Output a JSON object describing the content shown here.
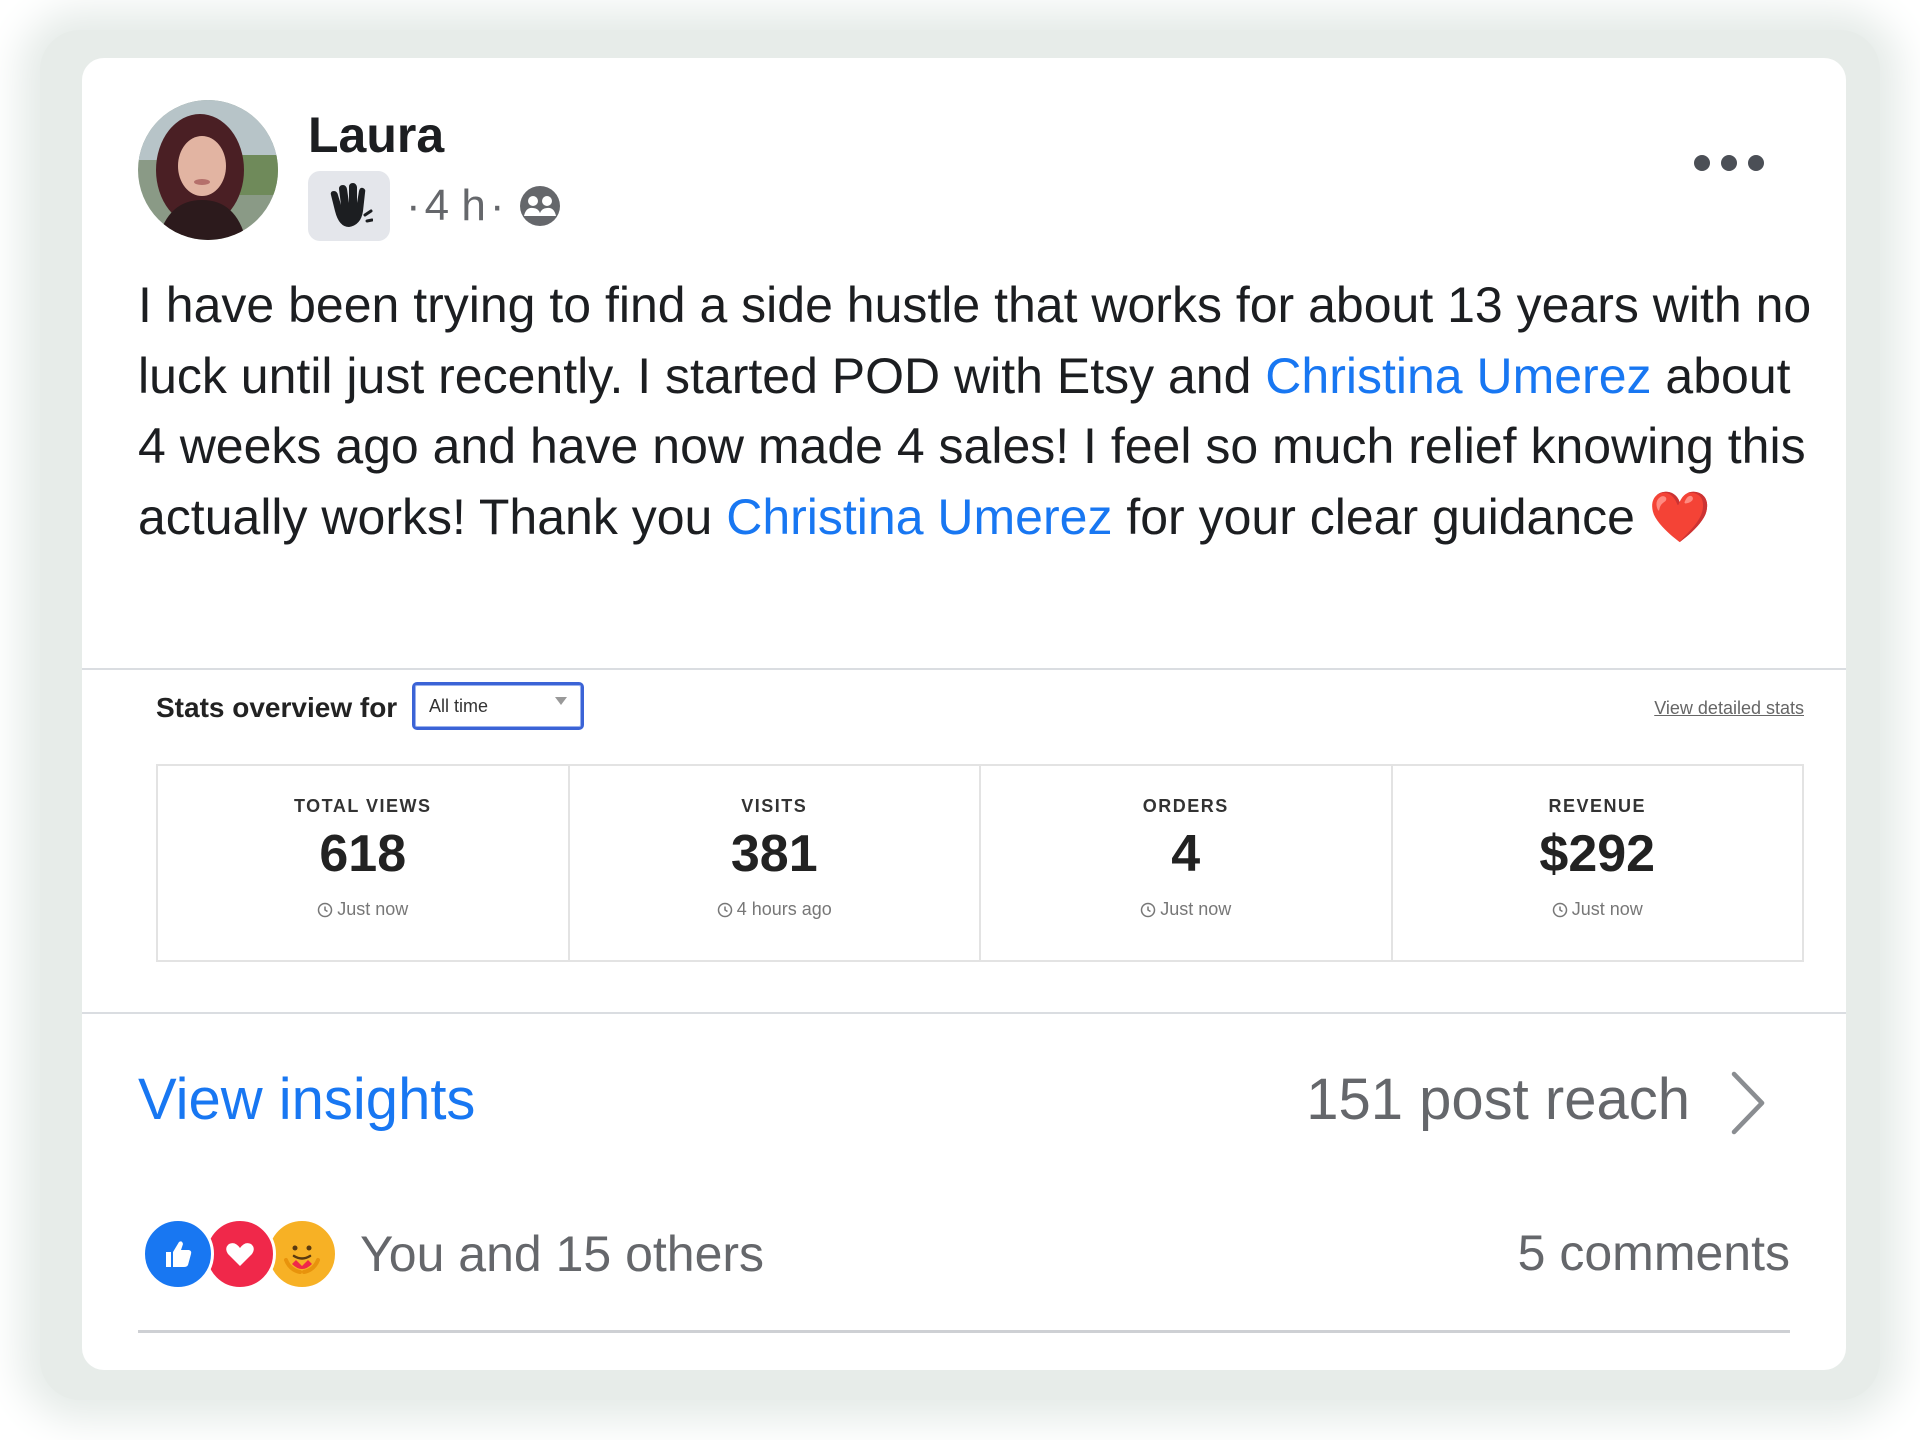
{
  "post": {
    "author": "Laura",
    "time": "4 h",
    "text_parts": {
      "p1": "I have been trying to find a side hustle that works for about 13 years with no luck until just recently.  I started POD with Etsy and ",
      "mention1": "Christina Umerez",
      "p2": " about 4 weeks ago and have now made 4 sales!    I feel so much relief knowing this actually works! Thank you ",
      "mention2": "Christina Umerez",
      "p3": " for your clear guidance ",
      "emoji": "❤️"
    }
  },
  "stats": {
    "label": "Stats overview for",
    "period": "All time",
    "detail_link": "View detailed stats",
    "cards": [
      {
        "label": "TOTAL VIEWS",
        "value": "618",
        "time": "Just now"
      },
      {
        "label": "VISITS",
        "value": "381",
        "time": "4 hours ago"
      },
      {
        "label": "ORDERS",
        "value": "4",
        "time": "Just now"
      },
      {
        "label": "REVENUE",
        "value": "$292",
        "time": "Just now"
      }
    ]
  },
  "footer": {
    "insights": "View insights",
    "reach": "151 post reach",
    "reactions_text": "You and 15 others",
    "comments": "5 comments"
  },
  "colors": {
    "link": "#1877f2",
    "like": "#1877f2",
    "love": "#f0284a",
    "care": "#f7b125"
  },
  "icons": [
    "wave-badge-icon",
    "group-privacy-icon",
    "more-options-icon",
    "clock-icon",
    "chevron-right-icon",
    "like-reaction-icon",
    "love-reaction-icon",
    "care-reaction-icon"
  ]
}
